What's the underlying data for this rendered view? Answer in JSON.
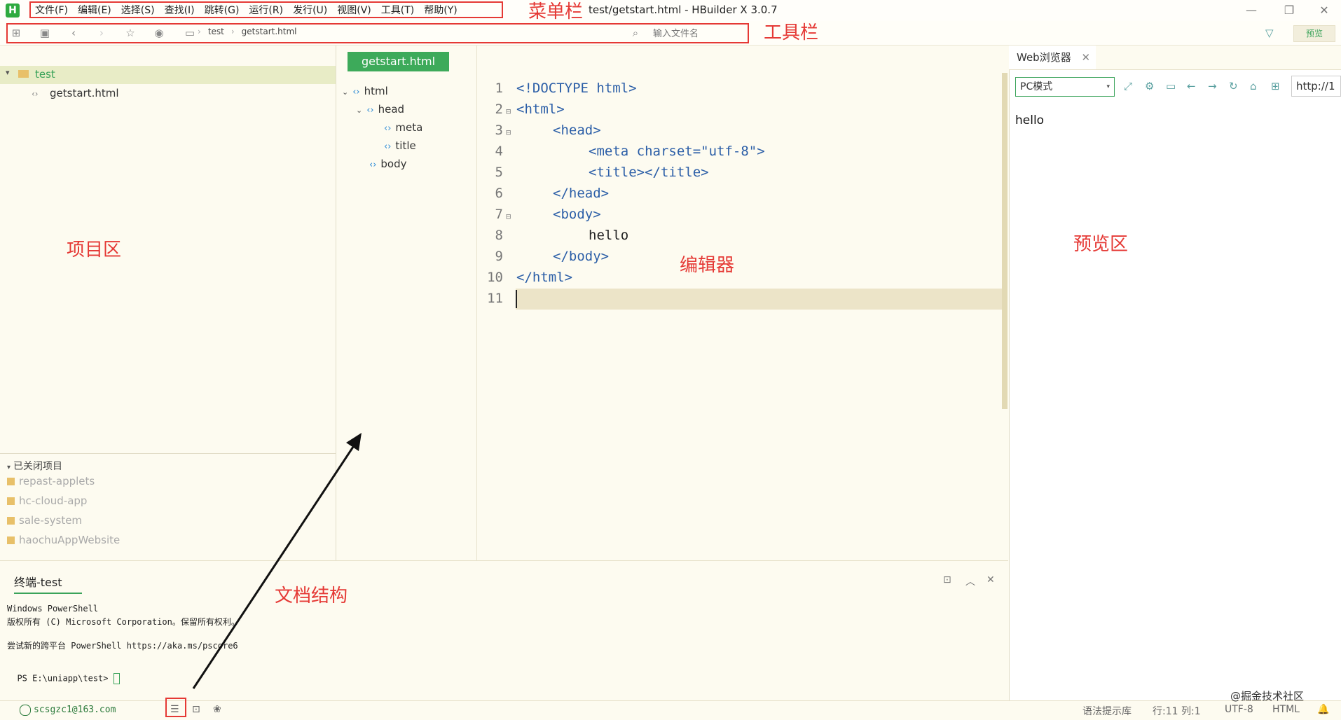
{
  "window": {
    "title": "test/getstart.html - HBuilder X 3.0.7",
    "logo": "H"
  },
  "menubar": {
    "items": [
      "文件(F)",
      "编辑(E)",
      "选择(S)",
      "查找(I)",
      "跳转(G)",
      "运行(R)",
      "发行(U)",
      "视图(V)",
      "工具(T)",
      "帮助(Y)"
    ]
  },
  "toolbar": {
    "path": [
      "test",
      "getstart.html"
    ],
    "file_search_placeholder": "输入文件名",
    "preview_label": "预览"
  },
  "annotations": {
    "menubar": "菜单栏",
    "toolbar": "工具栏",
    "project": "项目区",
    "editor": "编辑器",
    "preview": "预览区",
    "outline": "文档结构",
    "color": "#e53935"
  },
  "project": {
    "root": "test",
    "file": "getstart.html",
    "closed_header": "已关闭项目",
    "closed": [
      "repast-applets",
      "hc-cloud-app",
      "sale-system",
      "haochuAppWebsite"
    ]
  },
  "editor": {
    "tab": "getstart.html",
    "line_numbers": [
      "1",
      "2",
      "3",
      "4",
      "5",
      "6",
      "7",
      "8",
      "9",
      "10",
      "11"
    ],
    "code": [
      "<!DOCTYPE html>",
      "<html>",
      "<head>",
      "<meta charset=\"utf-8\">",
      "<title></title>",
      "</head>",
      "<body>",
      "hello",
      "</body>",
      "</html>",
      ""
    ]
  },
  "outline": {
    "items": [
      "html",
      "head",
      "meta",
      "title",
      "body"
    ]
  },
  "preview": {
    "tab": "Web浏览器",
    "mode": "PC模式",
    "url": "http://1",
    "content": "hello"
  },
  "terminal": {
    "tab": "终端-test",
    "lines": [
      "Windows PowerShell",
      "版权所有 (C) Microsoft Corporation。保留所有权利。",
      "",
      "尝试新的跨平台 PowerShell https://aka.ms/pscore6",
      "",
      "PS E:\\uniapp\\test> "
    ]
  },
  "statusbar": {
    "account": "scsgzc1@163.com",
    "syntax": "语法提示库",
    "position": "行:11  列:1",
    "encoding": "UTF-8",
    "language": "HTML",
    "watermark": "@掘金技术社区"
  },
  "colors": {
    "accent_green": "#3daa5a",
    "annotation_red": "#e53935",
    "editor_bg": "#fdfbf0"
  }
}
